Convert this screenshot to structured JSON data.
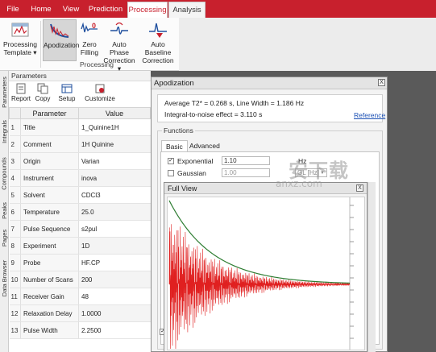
{
  "ribbon": {
    "tabs": [
      "File",
      "Home",
      "View",
      "Prediction",
      "Processing",
      "Analysis"
    ],
    "active_tab": "Processing",
    "buttons": [
      {
        "line1": "Processing",
        "line2": "Template ▾"
      },
      {
        "line1": "Apodization",
        "line2": ""
      },
      {
        "line1": "Zero",
        "line2": "Filling"
      },
      {
        "line1": "Auto Phase",
        "line2": "Correction ▾"
      },
      {
        "line1": "Auto Baseline",
        "line2": "Correction"
      }
    ],
    "group_label": "Processing",
    "zero_filling_badge": "0"
  },
  "side_tabs": [
    "Parameters",
    "Integrals",
    "Compounds",
    "Peaks",
    "Pages",
    "Data Browser"
  ],
  "parameters": {
    "title": "Parameters",
    "toolbar": [
      "Report",
      "Copy",
      "Setup",
      "Customize"
    ],
    "columns": [
      "Parameter",
      "Value"
    ],
    "rows": [
      {
        "num": "1",
        "name": "Title",
        "value": "1_Quinine1H"
      },
      {
        "num": "2",
        "name": "Comment",
        "value": "1H Quinine"
      },
      {
        "num": "3",
        "name": "Origin",
        "value": "Varian"
      },
      {
        "num": "4",
        "name": "Instrument",
        "value": "inova"
      },
      {
        "num": "5",
        "name": "Solvent",
        "value": "CDCl3"
      },
      {
        "num": "6",
        "name": "Temperature",
        "value": "25.0"
      },
      {
        "num": "7",
        "name": "Pulse Sequence",
        "value": "s2pul"
      },
      {
        "num": "8",
        "name": "Experiment",
        "value": "1D"
      },
      {
        "num": "9",
        "name": "Probe",
        "value": "HF.CP"
      },
      {
        "num": "10",
        "name": "Number of Scans",
        "value": "200"
      },
      {
        "num": "11",
        "name": "Receiver Gain",
        "value": "48"
      },
      {
        "num": "12",
        "name": "Relaxation Delay",
        "value": "1.0000"
      },
      {
        "num": "13",
        "name": "Pulse Width",
        "value": "2.2500"
      }
    ]
  },
  "apodization": {
    "title": "Apodization",
    "close": "X",
    "info_line1": "Average T2* = 0.268 s, Line Width = 1.186 Hz",
    "info_line2": "Integral-to-noise effect = 3.110 s",
    "reference_link": "Reference",
    "functions_label": "Functions",
    "subtabs": [
      "Basic",
      "Advanced"
    ],
    "exponential": {
      "label": "Exponential",
      "checked": true,
      "value": "1.10",
      "unit": "Hz"
    },
    "gaussian": {
      "label": "Gaussian",
      "checked": false,
      "value": "1.00",
      "unit": "GL [Hz]"
    }
  },
  "full_view": {
    "title": "Full View",
    "close": "X"
  },
  "watermark": {
    "text": "安下载",
    "sub": "anxz.com"
  },
  "colors": {
    "accent": "#c8202d",
    "fid": "#e02020",
    "envelope": "#2e7d32"
  }
}
